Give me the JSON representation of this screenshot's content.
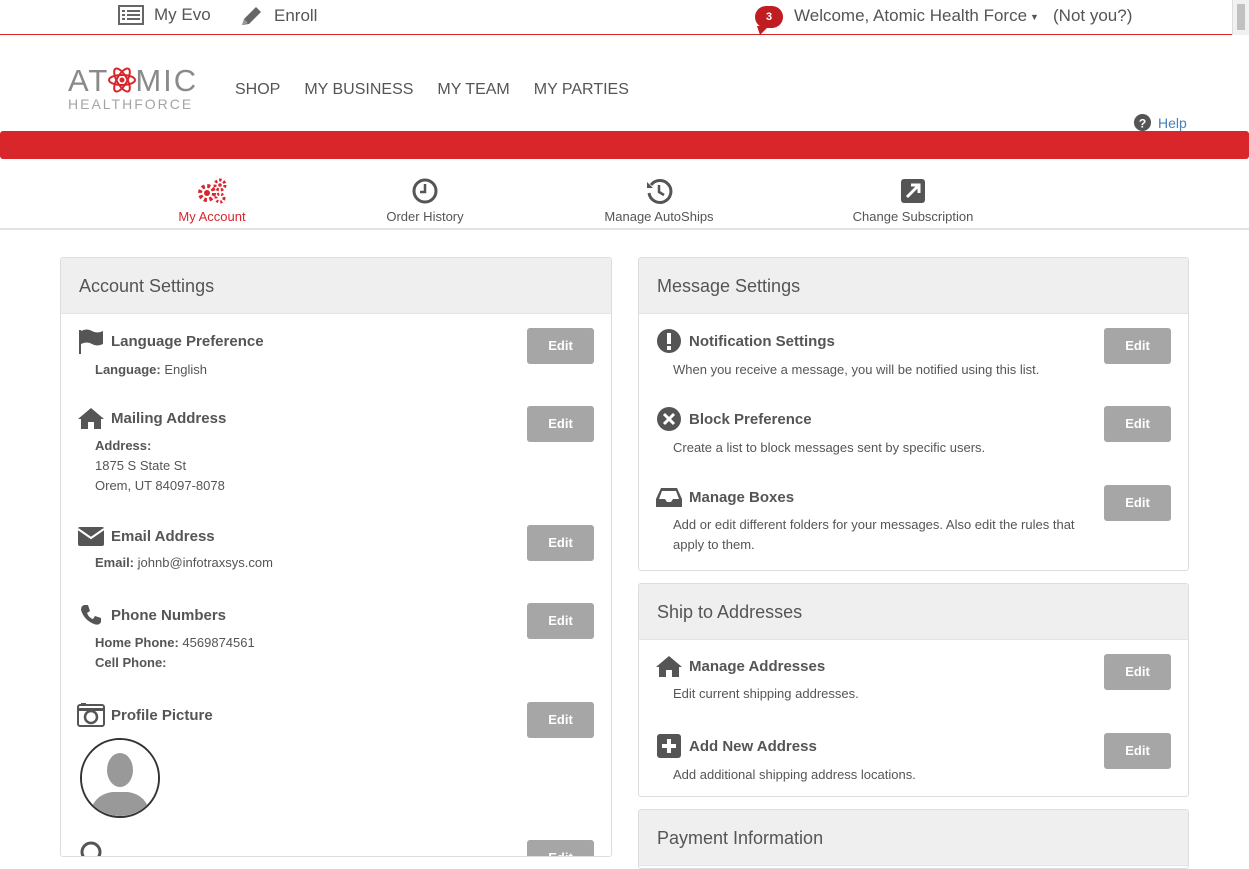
{
  "topbar": {
    "my_evo": "My Evo",
    "enroll": "Enroll",
    "notification_count": "3",
    "welcome": "Welcome, Atomic Health Force",
    "not_you": "(Not you?)"
  },
  "logo": {
    "line1_a": "AT",
    "line1_b": "MIC",
    "line2": "HEALTHFORCE"
  },
  "mainnav": [
    "SHOP",
    "MY BUSINESS",
    "MY TEAM",
    "MY PARTIES"
  ],
  "help": "Help",
  "subnav": [
    {
      "label": "My Account",
      "icon": "gears-icon",
      "active": true
    },
    {
      "label": "Order History",
      "icon": "clock-icon",
      "active": false
    },
    {
      "label": "Manage AutoShips",
      "icon": "history-icon",
      "active": false
    },
    {
      "label": "Change Subscription",
      "icon": "external-link-icon",
      "active": false
    }
  ],
  "account_settings": {
    "title": "Account Settings",
    "edit_label": "Edit",
    "language": {
      "title": "Language Preference",
      "label": "Language:",
      "value": "English"
    },
    "mailing": {
      "title": "Mailing Address",
      "label": "Address:",
      "line1": "1875 S State St",
      "line2": "Orem, UT 84097-8078"
    },
    "email": {
      "title": "Email Address",
      "label": "Email:",
      "value": "johnb@infotraxsys.com"
    },
    "phone": {
      "title": "Phone Numbers",
      "home_label": "Home Phone:",
      "home_value": "4569874561",
      "cell_label": "Cell Phone:",
      "cell_value": ""
    },
    "profile": {
      "title": "Profile Picture"
    }
  },
  "message_settings": {
    "title": "Message Settings",
    "notification": {
      "title": "Notification Settings",
      "desc": "When you receive a message, you will be notified using this list."
    },
    "block": {
      "title": "Block Preference",
      "desc": "Create a list to block messages sent by specific users."
    },
    "boxes": {
      "title": "Manage Boxes",
      "desc": "Add or edit different folders for your messages. Also edit the rules that apply to them."
    }
  },
  "ship_to": {
    "title": "Ship to Addresses",
    "manage": {
      "title": "Manage Addresses",
      "desc": "Edit current shipping addresses."
    },
    "add": {
      "title": "Add New Address",
      "desc": "Add additional shipping address locations."
    }
  },
  "payment": {
    "title": "Payment Information"
  },
  "colors": {
    "brand_red": "#d9262b",
    "edit_button": "#a6a6a6",
    "panel_header": "#efefef"
  }
}
